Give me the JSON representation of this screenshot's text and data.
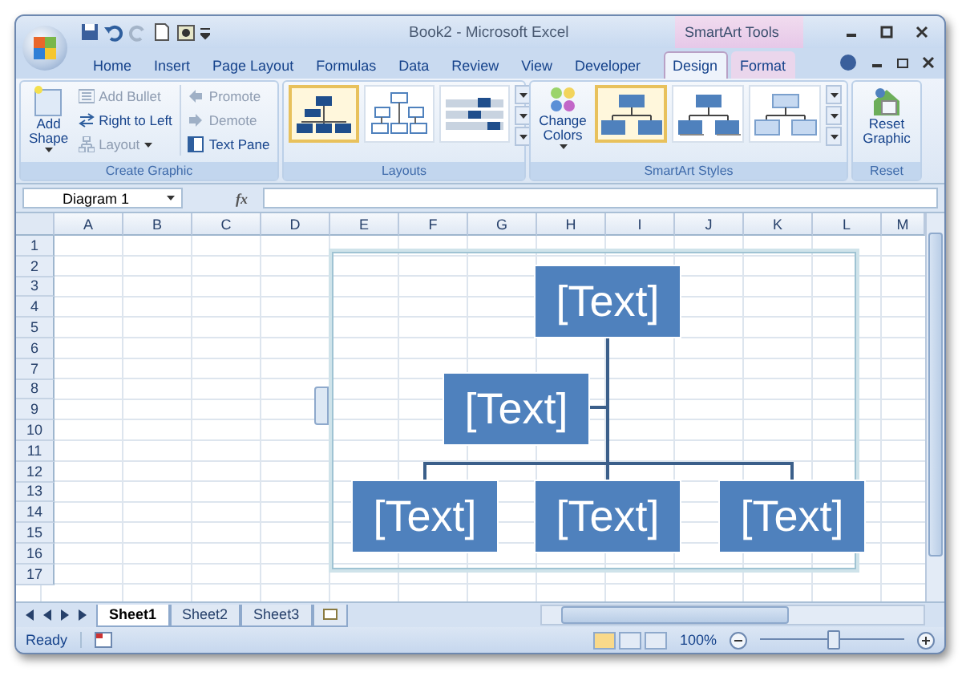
{
  "window": {
    "title": "Book2 - Microsoft Excel",
    "context_group": "SmartArt Tools"
  },
  "tabs": [
    {
      "label": "Home",
      "selected": false,
      "contextual": false
    },
    {
      "label": "Insert",
      "selected": false,
      "contextual": false
    },
    {
      "label": "Page Layout",
      "selected": false,
      "contextual": false
    },
    {
      "label": "Formulas",
      "selected": false,
      "contextual": false
    },
    {
      "label": "Data",
      "selected": false,
      "contextual": false
    },
    {
      "label": "Review",
      "selected": false,
      "contextual": false
    },
    {
      "label": "View",
      "selected": false,
      "contextual": false
    },
    {
      "label": "Developer",
      "selected": false,
      "contextual": false
    },
    {
      "label": "Design",
      "selected": true,
      "contextual": true
    },
    {
      "label": "Format",
      "selected": false,
      "contextual": true
    }
  ],
  "ribbon": {
    "groups": [
      {
        "label": "Create Graphic",
        "kind": "commands",
        "large": {
          "label": "Add Shape",
          "dropdown": true
        },
        "columns": [
          [
            {
              "label": "Add Bullet",
              "disabled": true
            },
            {
              "label": "Right to Left",
              "disabled": false
            },
            {
              "label": "Layout",
              "disabled": true,
              "dropdown": true
            }
          ],
          [
            {
              "label": "Promote",
              "disabled": true
            },
            {
              "label": "Demote",
              "disabled": true
            },
            {
              "label": "Text Pane",
              "disabled": false
            }
          ]
        ]
      },
      {
        "label": "Layouts",
        "kind": "gallery",
        "items": [
          {
            "selected": true
          },
          {
            "selected": false
          },
          {
            "selected": false
          }
        ]
      },
      {
        "label": "SmartArt Styles",
        "kind": "styles",
        "large": {
          "label": "Change Colors",
          "dropdown": true
        },
        "items": [
          {
            "selected": true
          },
          {
            "selected": false
          },
          {
            "selected": false
          }
        ]
      },
      {
        "label": "Reset",
        "kind": "reset",
        "large": {
          "label": "Reset Graphic"
        }
      }
    ]
  },
  "formula_bar": {
    "name_box": "Diagram 1",
    "function_label": "fx"
  },
  "columns": [
    "A",
    "B",
    "C",
    "D",
    "E",
    "F",
    "G",
    "H",
    "I",
    "J",
    "K",
    "L",
    "M"
  ],
  "rows": [
    "1",
    "2",
    "3",
    "4",
    "5",
    "6",
    "7",
    "8",
    "9",
    "10",
    "11",
    "12",
    "13",
    "14",
    "15",
    "16",
    "17"
  ],
  "smartart": {
    "nodes": [
      {
        "text": "[Text]"
      },
      {
        "text": "[Text]"
      },
      {
        "text": "[Text]"
      },
      {
        "text": "[Text]"
      },
      {
        "text": "[Text]"
      }
    ]
  },
  "sheet_tabs": [
    {
      "label": "Sheet1",
      "selected": true
    },
    {
      "label": "Sheet2",
      "selected": false
    },
    {
      "label": "Sheet3",
      "selected": false
    }
  ],
  "status_bar": {
    "status": "Ready",
    "zoom": "100%",
    "zoom_level": {
      "level": 0.5
    }
  }
}
